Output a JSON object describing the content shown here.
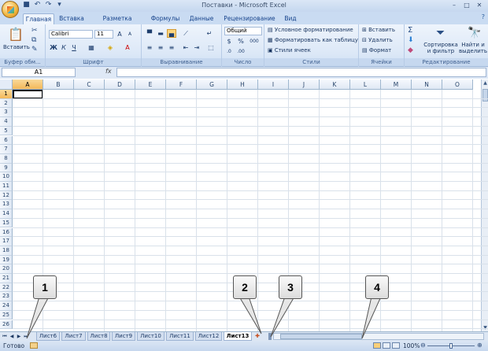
{
  "window": {
    "title": "Поставки - Microsoft Excel"
  },
  "ribbon": {
    "tabs": [
      "Главная",
      "Вставка",
      "Разметка страницы",
      "Формулы",
      "Данные",
      "Рецензирование",
      "Вид"
    ],
    "active_tab": "Главная",
    "groups": {
      "clipboard": {
        "label": "Буфер обм...",
        "paste_label": "Вставить"
      },
      "font": {
        "label": "Шрифт",
        "font_name": "Calibri",
        "font_size": "11",
        "bold": "Ж",
        "italic": "К",
        "underline": "Ч"
      },
      "alignment": {
        "label": "Выравнивание"
      },
      "number": {
        "label": "Число",
        "format": "Общий",
        "percent": "%",
        "thousands": "000"
      },
      "styles": {
        "label": "Стили",
        "conditional": "Условное форматирование",
        "as_table": "Форматировать как таблицу",
        "cell_styles": "Стили ячеек"
      },
      "cells": {
        "label": "Ячейки",
        "insert": "Вставить",
        "delete": "Удалить",
        "format": "Формат"
      },
      "editing": {
        "label": "Редактирование",
        "sort": "Сортировка и фильтр",
        "find": "Найти и выделить"
      }
    }
  },
  "formula_bar": {
    "name_box": "A1",
    "fx": "fx",
    "value": ""
  },
  "grid": {
    "columns": [
      "A",
      "B",
      "C",
      "D",
      "E",
      "F",
      "G",
      "H",
      "I",
      "J",
      "K",
      "L",
      "M",
      "N",
      "O"
    ],
    "rows": [
      "1",
      "2",
      "3",
      "4",
      "5",
      "6",
      "7",
      "8",
      "9",
      "10",
      "11",
      "12",
      "13",
      "14",
      "15",
      "16",
      "17",
      "18",
      "19",
      "20",
      "21",
      "22",
      "23",
      "24",
      "25",
      "26"
    ],
    "active_cell": "A1"
  },
  "sheets": {
    "tabs": [
      "Лист6",
      "Лист7",
      "Лист8",
      "Лист9",
      "Лист10",
      "Лист11",
      "Лист12",
      "Лист13"
    ],
    "active": "Лист13"
  },
  "status": {
    "ready": "Готово",
    "zoom": "100%"
  },
  "callouts": [
    "1",
    "2",
    "3",
    "4"
  ]
}
